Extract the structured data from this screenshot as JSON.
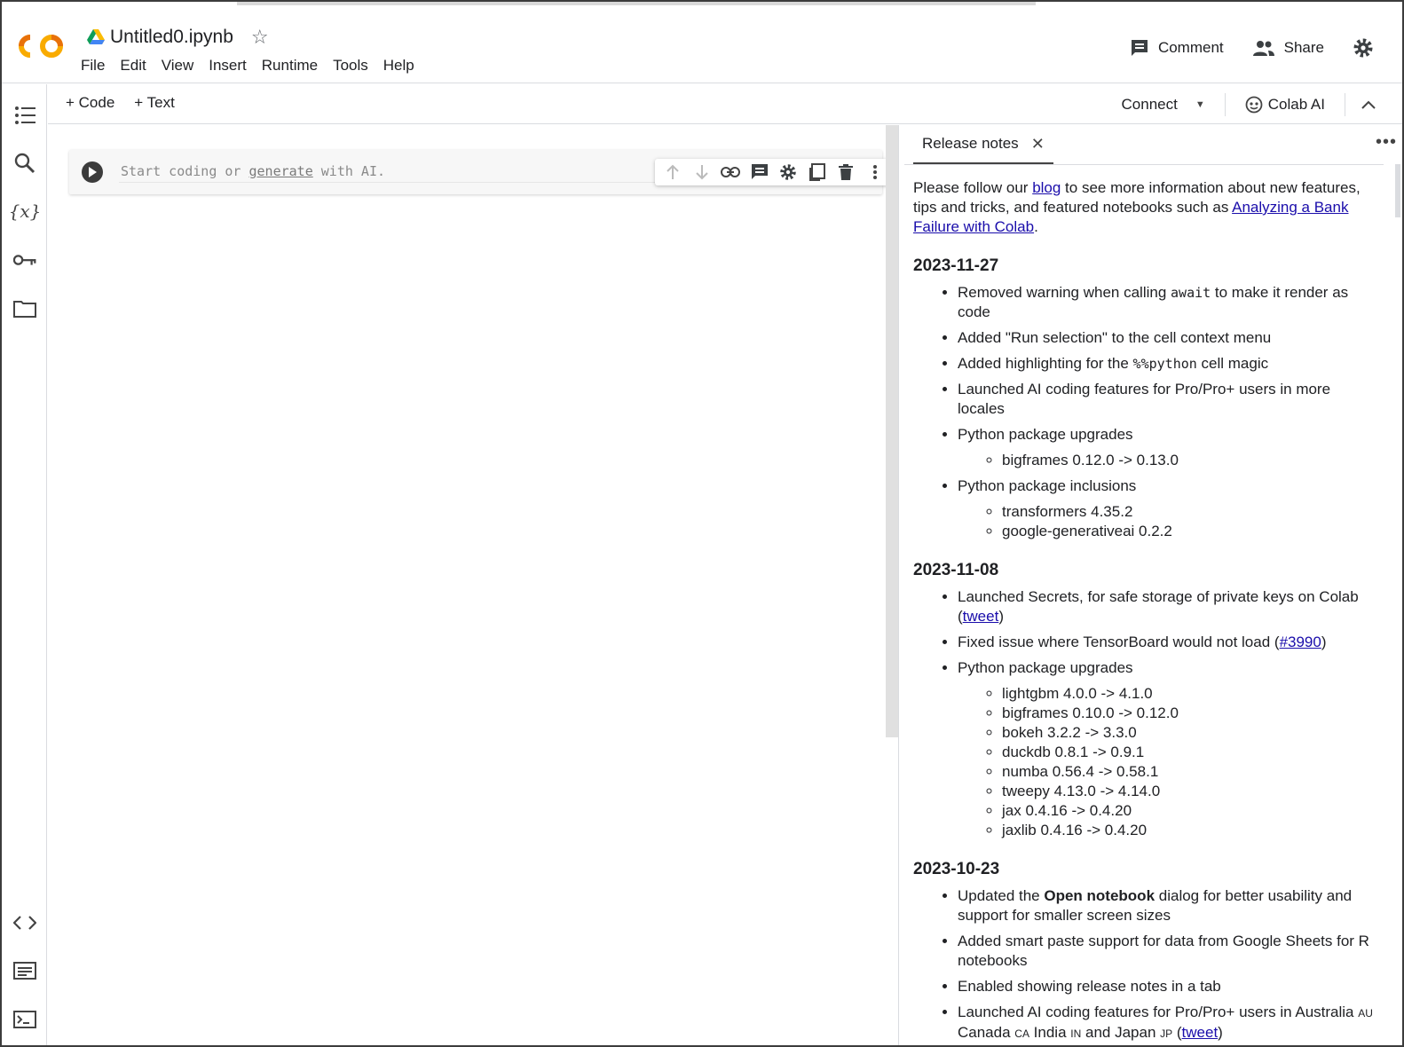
{
  "header": {
    "doc_title": "Untitled0.ipynb",
    "menu": [
      "File",
      "Edit",
      "View",
      "Insert",
      "Runtime",
      "Tools",
      "Help"
    ],
    "comment_label": "Comment",
    "share_label": "Share"
  },
  "toolbar": {
    "add_code": "+ Code",
    "add_text": "+ Text",
    "connect": "Connect",
    "colab_ai": "Colab AI"
  },
  "cell": {
    "placeholder_start": "Start coding or ",
    "placeholder_link": "generate",
    "placeholder_end": " with AI."
  },
  "panel": {
    "tab_label": "Release notes",
    "intro_1": "Please follow our ",
    "intro_blog": "blog",
    "intro_2": " to see more information about new features, tips and tricks, and featured notebooks such as ",
    "intro_link": "Analyzing a Bank Failure with Colab",
    "intro_3": ".",
    "sections": [
      {
        "date": "2023-11-27",
        "items": {
          "i0_a": "Removed warning when calling ",
          "i0_code": "await",
          "i0_b": " to make it render as code",
          "i1": "Added \"Run selection\" to the cell context menu",
          "i2_a": "Added highlighting for the ",
          "i2_code": "%%python",
          "i2_b": " cell magic",
          "i3": "Launched AI coding features for Pro/Pro+ users in more locales",
          "i4": "Python package upgrades",
          "i4_sub": [
            "bigframes 0.12.0 -> 0.13.0"
          ],
          "i5": "Python package inclusions",
          "i5_sub": [
            "transformers 4.35.2",
            "google-generativeai 0.2.2"
          ]
        }
      },
      {
        "date": "2023-11-08",
        "items": {
          "i0_a": "Launched Secrets, for safe storage of private keys on Colab (",
          "i0_link": "tweet",
          "i0_b": ")",
          "i1_a": "Fixed issue where TensorBoard would not load (",
          "i1_link": "#3990",
          "i1_b": ")",
          "i2": "Python package upgrades",
          "i2_sub": [
            "lightgbm 4.0.0 -> 4.1.0",
            "bigframes 0.10.0 -> 0.12.0",
            "bokeh 3.2.2 -> 3.3.0",
            "duckdb 0.8.1 -> 0.9.1",
            "numba 0.56.4 -> 0.58.1",
            "tweepy 4.13.0 -> 4.14.0",
            "jax 0.4.16 -> 0.4.20",
            "jaxlib 0.4.16 -> 0.4.20"
          ]
        }
      },
      {
        "date": "2023-10-23",
        "items": {
          "i0_a": "Updated the ",
          "i0_bold": "Open notebook",
          "i0_b": " dialog for better usability and support for smaller screen sizes",
          "i1": "Added smart paste support for data from Google Sheets for R notebooks",
          "i2": "Enabled showing release notes in a tab",
          "i3_a": "Launched AI coding features for Pro/Pro+ users in Australia ",
          "i3_au": "AU",
          "i3_b": " Canada ",
          "i3_ca": "CA",
          "i3_c": " India ",
          "i3_in": "IN",
          "i3_d": " and Japan ",
          "i3_jp": "JP",
          "i3_e": " (",
          "i3_link": "tweet",
          "i3_f": ")"
        }
      }
    ]
  }
}
